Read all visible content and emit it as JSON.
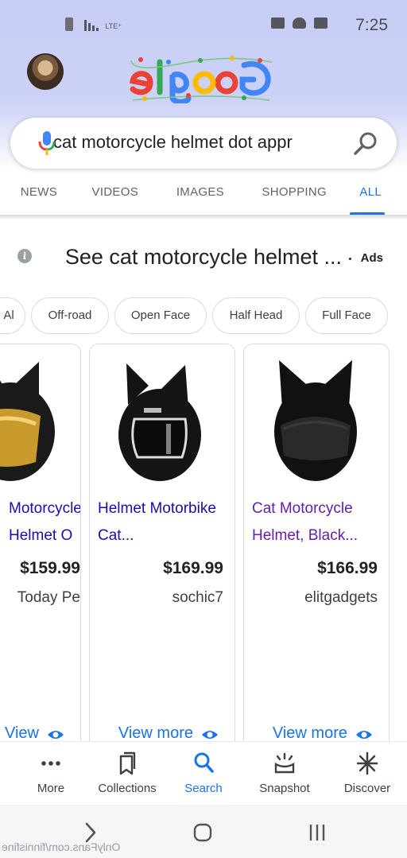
{
  "status": {
    "time": "7:25",
    "network": "LTE⁺"
  },
  "search": {
    "query": "cat motorcycle helmet dot appr"
  },
  "tabs": [
    {
      "label": "ALL"
    },
    {
      "label": "SHOPPING"
    },
    {
      "label": "IMAGES"
    },
    {
      "label": "VIDEOS"
    },
    {
      "label": "NEWS"
    }
  ],
  "ads": {
    "label": "Ads",
    "title": "See cat motorcycle helmet ..."
  },
  "chips": [
    {
      "label": "Full Face"
    },
    {
      "label": "Half Head"
    },
    {
      "label": "Open Face"
    },
    {
      "label": "Off-road"
    },
    {
      "label": "Al"
    }
  ],
  "products": [
    {
      "title": "Cat Motorcycle Helmet, Black...",
      "price": "$166.99",
      "seller": "elitgadgets",
      "view_more": "View more",
      "helmet_color": "#111111",
      "visited": true
    },
    {
      "title": "Helmet Motorbike Cat...",
      "price": "$169.99",
      "seller": "sochic7",
      "view_more": "View more",
      "helmet_color": "#141414",
      "visited": false
    },
    {
      "title": "Motorcycle Helmet O",
      "price": "$159.99",
      "seller": "Today Pe",
      "view_more": "View",
      "helmet_color": "#1a1a1a",
      "visited": false
    }
  ],
  "bottom_nav": [
    {
      "label": "Discover",
      "icon": "asterisk-icon"
    },
    {
      "label": "Snapshot",
      "icon": "snapshot-icon"
    },
    {
      "label": "Search",
      "icon": "search-icon"
    },
    {
      "label": "Collections",
      "icon": "bookmarks-icon"
    },
    {
      "label": "More",
      "icon": "more-dots-icon"
    }
  ],
  "colors": {
    "accent": "#1a73e8",
    "link": "#1a0dab",
    "visited": "#681da8",
    "header_bg": "#c7cdf6"
  },
  "watermark": "OnlyFans.com/finnisfine"
}
